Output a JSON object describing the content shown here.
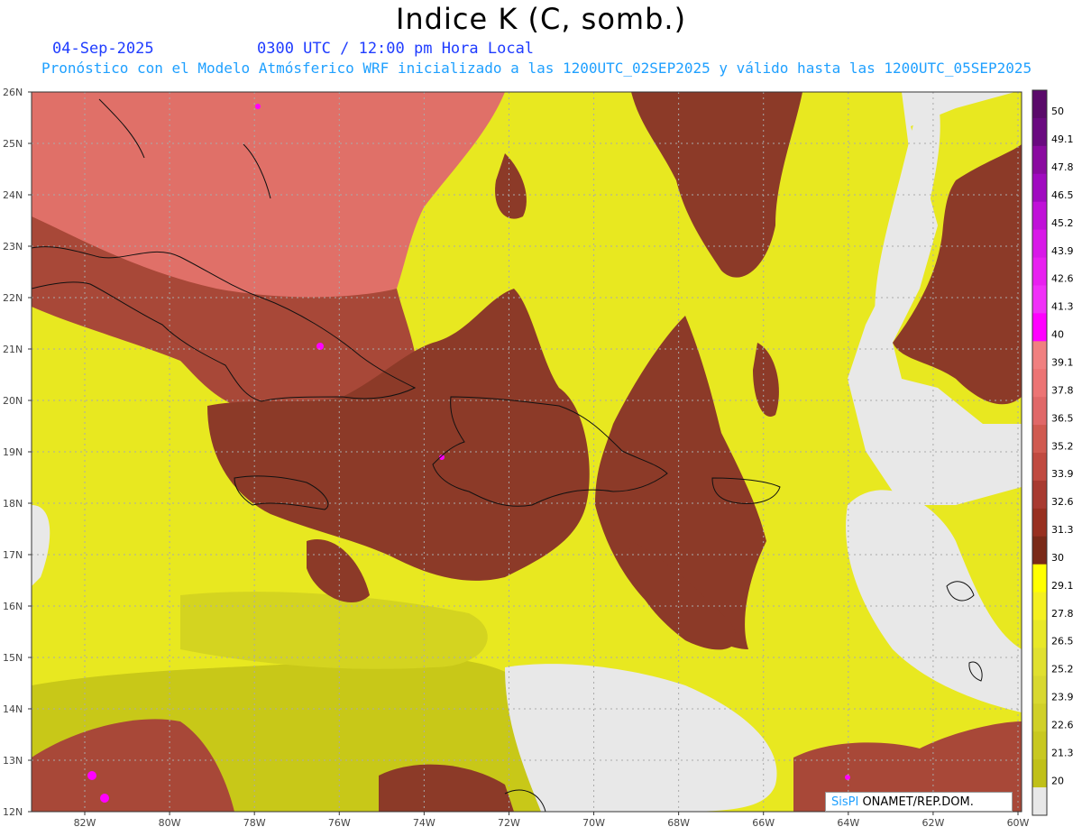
{
  "header": {
    "title": "Indice K (C, somb.)",
    "date": "04-Sep-2025",
    "time": "0300 UTC / 12:00 pm Hora Local",
    "subtitle": "Pronóstico con el Modelo Atmósferico WRF inicializado a las 1200UTC_02SEP2025 y válido hasta las  1200UTC_05SEP2025"
  },
  "axes": {
    "lat_labels": [
      "26N",
      "25N",
      "24N",
      "23N",
      "22N",
      "21N",
      "20N",
      "19N",
      "18N",
      "17N",
      "16N",
      "15N",
      "14N",
      "13N",
      "12N"
    ],
    "lon_labels": [
      "82W",
      "80W",
      "78W",
      "76W",
      "74W",
      "72W",
      "70W",
      "68W",
      "66W",
      "64W",
      "62W",
      "60W"
    ]
  },
  "colorbar": {
    "levels": [
      "50",
      "49.1",
      "47.8",
      "46.5",
      "45.2",
      "43.9",
      "42.6",
      "41.3",
      "40",
      "39.1",
      "37.8",
      "36.5",
      "35.2",
      "33.9",
      "32.6",
      "31.3",
      "30",
      "29.1",
      "27.8",
      "26.5",
      "25.2",
      "23.9",
      "22.6",
      "21.3",
      "20"
    ],
    "colors": [
      "#5a0a6a",
      "#6a0a80",
      "#8a0aa0",
      "#a00ac0",
      "#c010d8",
      "#d818e8",
      "#e820f0",
      "#f030f8",
      "#ff00ff",
      "#f08080",
      "#ec7474",
      "#e06868",
      "#d05a50",
      "#c04a40",
      "#a83a30",
      "#983020",
      "#7a2a18",
      "#ffff00",
      "#f4f020",
      "#e8e828",
      "#e0e030",
      "#d8d830",
      "#d0d028",
      "#c8c820",
      "#c0c018",
      "#e8e8e8"
    ]
  },
  "map_colors": {
    "background": "#e8e8e8",
    "yellow": "#e8e820",
    "yellow_light": "#f2f020",
    "olive": "#c8c818",
    "brown": "#8c3a28",
    "brown_mid": "#a84838",
    "salmon": "#e07068",
    "magenta": "#ff00ff"
  },
  "credit": {
    "brand": "SisPI",
    "org": " ONAMET/REP.DOM."
  }
}
